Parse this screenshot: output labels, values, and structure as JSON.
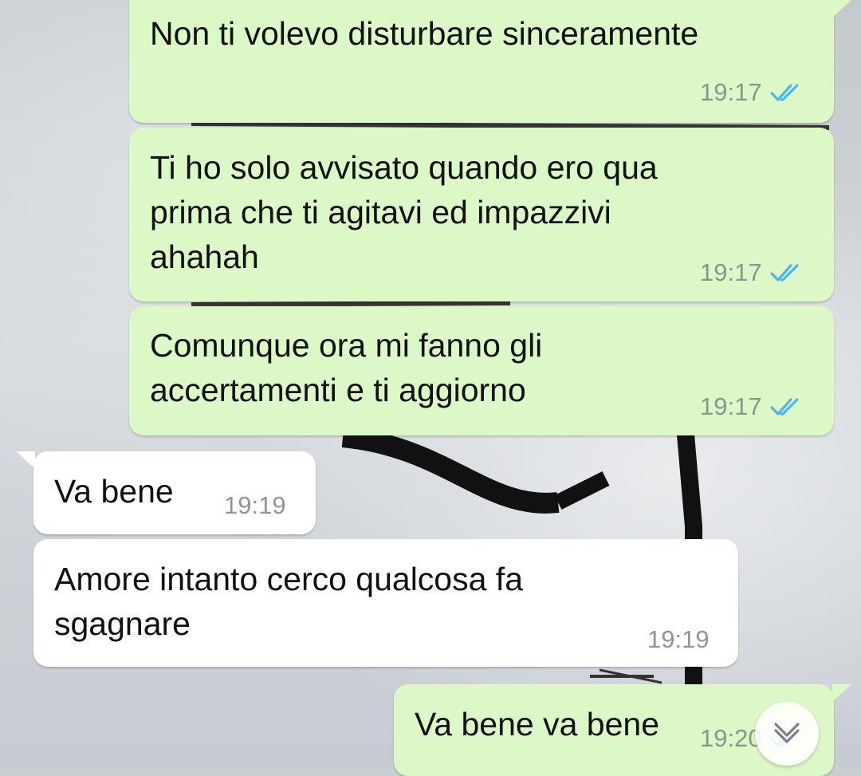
{
  "messages": [
    {
      "direction": "outgoing",
      "text": "Non ti volevo disturbare sinceramente",
      "time": "19:17",
      "status": "read"
    },
    {
      "direction": "outgoing",
      "text": "Ti ho solo avvisato quando ero qua\nprima che ti agitavi ed impazzivi\nahahah",
      "time": "19:17",
      "status": "read"
    },
    {
      "direction": "outgoing",
      "text": "Comunque ora mi fanno gli\naccertamenti e ti aggiorno",
      "time": "19:17",
      "status": "read"
    },
    {
      "direction": "incoming",
      "text": "Va bene",
      "time": "19:19"
    },
    {
      "direction": "incoming",
      "text": "Amore intanto cerco qualcosa fa\nsgagnare",
      "time": "19:19"
    },
    {
      "direction": "outgoing",
      "text": "Va bene va bene",
      "time": "19:20",
      "status": "read"
    }
  ],
  "colors": {
    "outgoing_bubble": "#dcf8c6",
    "incoming_bubble": "#ffffff",
    "read_ticks": "#4fb6ec"
  },
  "icons": {
    "read_receipt": "double-check-icon",
    "scroll_down": "chevron-down-icon"
  }
}
